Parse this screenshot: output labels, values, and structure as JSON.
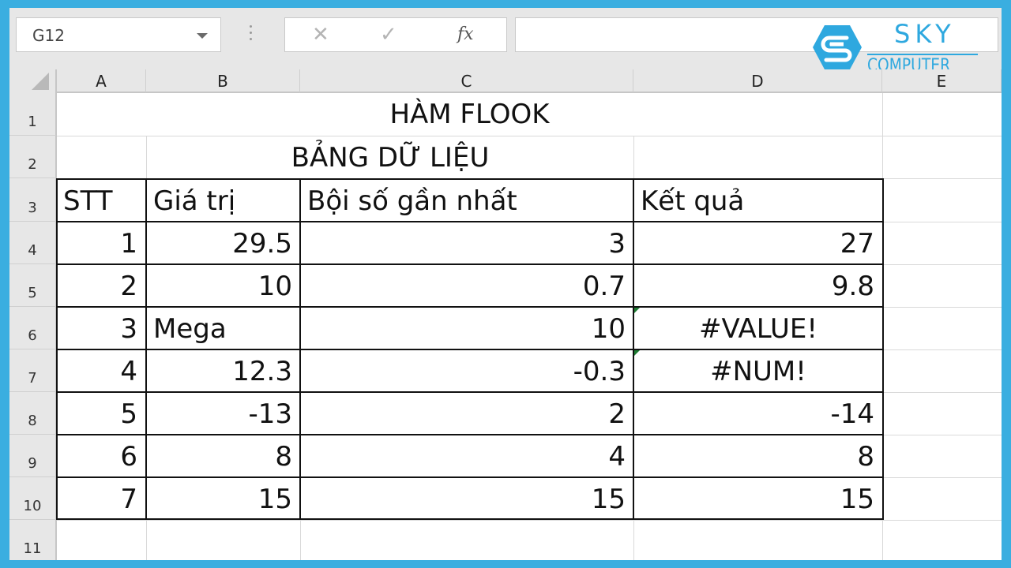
{
  "formula_bar": {
    "name_box": "G12",
    "cancel_icon": "✕",
    "enter_icon": "✓",
    "fx_label": "fx",
    "formula": ""
  },
  "logo": {
    "brand_top": "SKY",
    "brand_bottom": "COMPUTER",
    "color": "#2ea8df"
  },
  "columns": [
    "A",
    "B",
    "C",
    "D",
    "E"
  ],
  "rows": [
    "1",
    "2",
    "3",
    "4",
    "5",
    "6",
    "7",
    "8",
    "9",
    "10",
    "11"
  ],
  "sheet": {
    "title": "HÀM FLOOK",
    "subtitle": "BẢNG DỮ LIỆU",
    "headers": [
      "STT",
      "Giá trị",
      "Bội số gần nhất",
      "Kết quả"
    ],
    "data": [
      {
        "stt": "1",
        "value": "29.5",
        "multiple": "3",
        "result": "27"
      },
      {
        "stt": "2",
        "value": "10",
        "multiple": "0.7",
        "result": "9.8"
      },
      {
        "stt": "3",
        "value": "Mega",
        "multiple": "10",
        "result": "#VALUE!"
      },
      {
        "stt": "4",
        "value": "12.3",
        "multiple": "-0.3",
        "result": "#NUM!"
      },
      {
        "stt": "5",
        "value": "-13",
        "multiple": "2",
        "result": "-14"
      },
      {
        "stt": "6",
        "value": "8",
        "multiple": "4",
        "result": "8"
      },
      {
        "stt": "7",
        "value": "15",
        "multiple": "15",
        "result": "15"
      }
    ]
  },
  "colors": {
    "frame": "#3aaee0",
    "error_indicator": "#1e7c33"
  }
}
